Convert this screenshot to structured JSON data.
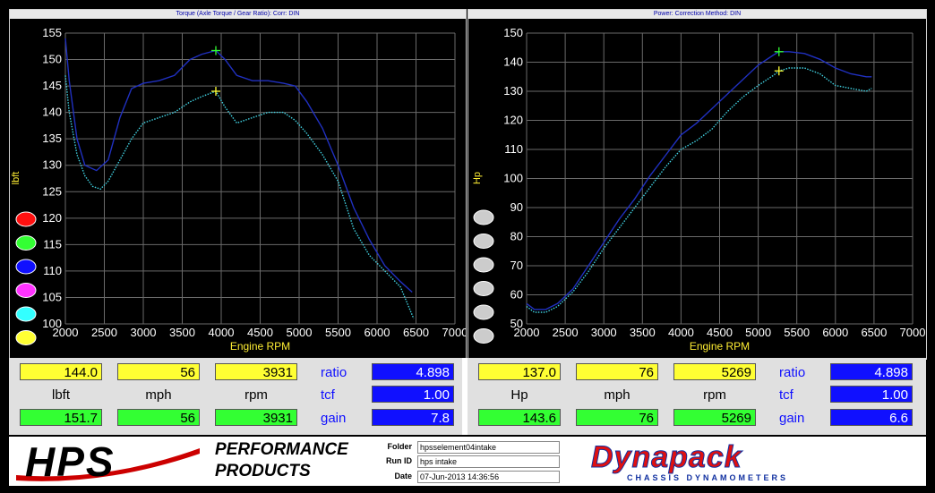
{
  "chart_data": [
    {
      "type": "line",
      "title": "Torque (Axle Torque / Gear Ratio):    Corr: DIN",
      "xlabel": "Engine RPM",
      "ylabel": "lbft",
      "xlim": [
        2000,
        7000
      ],
      "ylim": [
        100,
        155
      ],
      "xticks": [
        2000,
        2500,
        3000,
        3500,
        4000,
        4500,
        5000,
        5500,
        6000,
        6500,
        7000
      ],
      "yticks": [
        100,
        105,
        110,
        115,
        120,
        125,
        130,
        135,
        140,
        145,
        150,
        155
      ],
      "series": [
        {
          "color": "#2030c0",
          "style": "solid",
          "x": [
            2000,
            2050,
            2150,
            2250,
            2400,
            2550,
            2700,
            2850,
            3000,
            3200,
            3400,
            3600,
            3750,
            3931,
            4050,
            4200,
            4400,
            4600,
            4800,
            4950,
            5100,
            5300,
            5500,
            5700,
            5900,
            6100,
            6300,
            6450
          ],
          "y": [
            154,
            146,
            135,
            130,
            129,
            131,
            139,
            144.5,
            145.5,
            146,
            147,
            150,
            151,
            151.7,
            150,
            147,
            146,
            146,
            145.5,
            145,
            142,
            137,
            130,
            122,
            116,
            111,
            108,
            106
          ]
        },
        {
          "color": "#40d0e0",
          "style": "dotted",
          "x": [
            2000,
            2050,
            2150,
            2250,
            2350,
            2450,
            2550,
            2700,
            2850,
            3000,
            3200,
            3400,
            3600,
            3750,
            3931,
            4050,
            4200,
            4400,
            4600,
            4800,
            4950,
            5100,
            5300,
            5500,
            5700,
            5900,
            6100,
            6300,
            6470
          ],
          "y": [
            147,
            140,
            132,
            128,
            126,
            125.5,
            127,
            131,
            135,
            138,
            139,
            140,
            142,
            143,
            144,
            141,
            138,
            139,
            140,
            140,
            138.5,
            136,
            132,
            127,
            118,
            113,
            110,
            107,
            101
          ]
        }
      ],
      "markers": [
        {
          "x": 3931,
          "y": 151.7,
          "color": "#33ff33"
        },
        {
          "x": 3931,
          "y": 144.0,
          "color": "#ffff33"
        }
      ],
      "legend_colors": [
        "#ff1010",
        "#33ff33",
        "#1010ff",
        "#ff33ff",
        "#33ffff",
        "#ffff33"
      ]
    },
    {
      "type": "line",
      "title": "Power:      Correction Method: DIN",
      "xlabel": "Engine RPM",
      "ylabel": "Hp",
      "xlim": [
        2000,
        7000
      ],
      "ylim": [
        50,
        150
      ],
      "xticks": [
        2000,
        2500,
        3000,
        3500,
        4000,
        4500,
        5000,
        5500,
        6000,
        6500,
        7000
      ],
      "yticks": [
        50,
        60,
        70,
        80,
        90,
        100,
        110,
        120,
        130,
        140,
        150
      ],
      "series": [
        {
          "color": "#2030c0",
          "style": "solid",
          "x": [
            2000,
            2100,
            2250,
            2400,
            2600,
            2800,
            3000,
            3200,
            3400,
            3600,
            3800,
            4000,
            4200,
            4400,
            4600,
            4800,
            5000,
            5200,
            5269,
            5400,
            5600,
            5800,
            6000,
            6200,
            6400,
            6470
          ],
          "y": [
            57,
            55,
            55,
            57,
            62,
            70,
            78,
            86,
            93,
            101,
            108,
            115,
            119,
            124,
            129,
            134,
            139,
            142.5,
            143.6,
            143.6,
            143,
            141,
            138,
            136,
            135,
            135
          ]
        },
        {
          "color": "#40d0e0",
          "style": "dotted",
          "x": [
            2000,
            2100,
            2250,
            2400,
            2600,
            2800,
            3000,
            3200,
            3400,
            3600,
            3800,
            4000,
            4200,
            4400,
            4600,
            4800,
            5000,
            5200,
            5269,
            5400,
            5600,
            5800,
            6000,
            6200,
            6400,
            6470
          ],
          "y": [
            56,
            54,
            54,
            56,
            61,
            68,
            76,
            83,
            90,
            97,
            104,
            110,
            113,
            117,
            123,
            128,
            132,
            135.5,
            137,
            138,
            138,
            136,
            132,
            131,
            130,
            131
          ]
        }
      ],
      "markers": [
        {
          "x": 5269,
          "y": 143.6,
          "color": "#33ff33"
        },
        {
          "x": 5269,
          "y": 137.0,
          "color": "#ffff33"
        }
      ],
      "legend_colors": [
        "#cccccc",
        "#cccccc",
        "#cccccc",
        "#cccccc",
        "#cccccc",
        "#cccccc"
      ]
    }
  ],
  "left_panel": {
    "row1": [
      "144.0",
      "56",
      "3931"
    ],
    "units": [
      "lbft",
      "mph",
      "rpm"
    ],
    "row2": [
      "151.7",
      "56",
      "3931"
    ],
    "labels": [
      "ratio",
      "tcf",
      "gain"
    ],
    "values": [
      "4.898",
      "1.00",
      "7.8"
    ]
  },
  "right_panel": {
    "row1": [
      "137.0",
      "76",
      "5269"
    ],
    "units": [
      "Hp",
      "mph",
      "rpm"
    ],
    "row2": [
      "143.6",
      "76",
      "5269"
    ],
    "labels": [
      "ratio",
      "tcf",
      "gain"
    ],
    "values": [
      "4.898",
      "1.00",
      "6.6"
    ]
  },
  "footer": {
    "brand_left": "HPS",
    "brand_left_sub1": "PERFORMANCE",
    "brand_left_sub2": "PRODUCTS",
    "folder_label": "Folder",
    "folder_value": "hpsselement04intake",
    "runid_label": "Run ID",
    "runid_value": "hps intake",
    "date_label": "Date",
    "date_value": "07-Jun-2013   14:36:56",
    "brand_right": "Dynapack",
    "brand_right_sub": "CHASSIS DYNAMOMETERS"
  }
}
